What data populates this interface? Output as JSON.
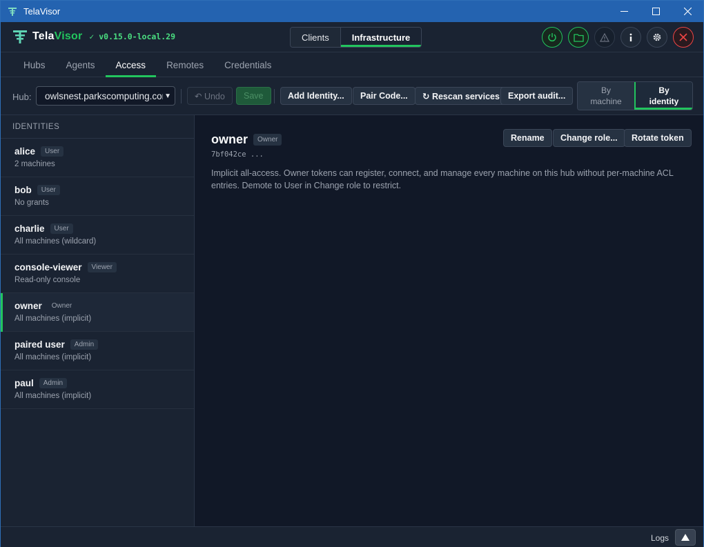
{
  "window": {
    "title": "TelaVisor",
    "minimize_icon": "minimize-icon",
    "maximize_icon": "maximize-icon",
    "close_icon": "close-icon"
  },
  "header": {
    "brand_prefix": "Tela",
    "brand_suffix": "Visor",
    "version": "✓ v0.15.0-local.29",
    "modes": [
      "Clients",
      "Infrastructure"
    ],
    "active_mode": "Infrastructure",
    "icons": [
      "power-icon",
      "folder-icon",
      "warning-icon",
      "info-icon",
      "settings-icon",
      "quit-icon"
    ]
  },
  "tabs": {
    "items": [
      "Hubs",
      "Agents",
      "Access",
      "Remotes",
      "Credentials"
    ],
    "active": "Access"
  },
  "toolbar": {
    "hub_label": "Hub:",
    "hub_value": "owlsnest.parkscomputing.com",
    "undo_label": "↶ Undo",
    "save_label": "Save",
    "add_identity_label": "Add Identity...",
    "pair_code_label": "Pair Code...",
    "rescan_label": "↻ Rescan services",
    "export_label": "Export audit...",
    "view_by_machine_label": "By machine",
    "view_by_identity_label": "By identity",
    "active_view": "By identity"
  },
  "sidebar": {
    "heading": "IDENTITIES",
    "items": [
      {
        "name": "alice",
        "role": "User",
        "sub": "2 machines"
      },
      {
        "name": "bob",
        "role": "User",
        "sub": "No grants"
      },
      {
        "name": "charlie",
        "role": "User",
        "sub": "All machines (wildcard)"
      },
      {
        "name": "console-viewer",
        "role": "Viewer",
        "sub": "Read-only console"
      },
      {
        "name": "owner",
        "role": "Owner",
        "sub": "All machines (implicit)"
      },
      {
        "name": "paired user",
        "role": "Admin",
        "sub": "All machines (implicit)"
      },
      {
        "name": "paul",
        "role": "Admin",
        "sub": "All machines (implicit)"
      }
    ],
    "selected": "owner"
  },
  "detail": {
    "name": "owner",
    "role": "Owner",
    "token": "7bf042ce ...",
    "description": "Implicit all-access. Owner tokens can register, connect, and manage every machine on this hub without per-machine ACL entries. Demote to User in Change role to restrict.",
    "rename_label": "Rename",
    "change_role_label": "Change role...",
    "rotate_token_label": "Rotate token"
  },
  "footer": {
    "logs_label": "Logs",
    "logs_toggle_icon": "triangle-up-icon"
  },
  "colors": {
    "accent": "#22c55e",
    "titlebar": "#2463b0",
    "background": "#111827",
    "panel": "#1a2332",
    "danger": "#ef4444"
  }
}
